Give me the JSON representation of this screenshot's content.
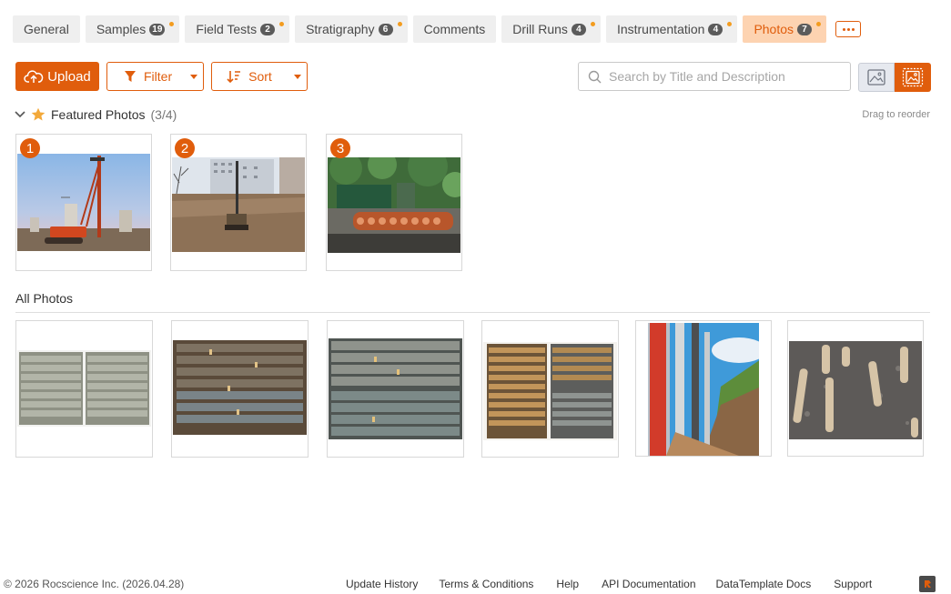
{
  "tabs": [
    {
      "label": "General",
      "badge": null,
      "dot": false,
      "active": false
    },
    {
      "label": "Samples",
      "badge": "19",
      "dot": true,
      "active": false
    },
    {
      "label": "Field Tests",
      "badge": "2",
      "dot": true,
      "active": false
    },
    {
      "label": "Stratigraphy",
      "badge": "6",
      "dot": true,
      "active": false
    },
    {
      "label": "Comments",
      "badge": null,
      "dot": false,
      "active": false
    },
    {
      "label": "Drill Runs",
      "badge": "4",
      "dot": true,
      "active": false
    },
    {
      "label": "Instrumentation",
      "badge": "4",
      "dot": true,
      "active": false
    },
    {
      "label": "Photos",
      "badge": "7",
      "dot": true,
      "active": true
    }
  ],
  "toolbar": {
    "upload_label": "Upload",
    "filter_label": "Filter",
    "sort_label": "Sort",
    "search_placeholder": "Search by Title and Description"
  },
  "featured": {
    "title": "Featured Photos",
    "count": "(3/4)",
    "drag_hint": "Drag to reorder",
    "photos": [
      {
        "number": "1",
        "subject": "drilling rig at sunset"
      },
      {
        "number": "2",
        "subject": "drilling rig on site"
      },
      {
        "number": "3",
        "subject": "core barrel auger"
      }
    ]
  },
  "all_photos": {
    "title": "All Photos",
    "photos": [
      {
        "subject": "core box grey"
      },
      {
        "subject": "core box dark"
      },
      {
        "subject": "core box grey banded"
      },
      {
        "subject": "core box brown"
      },
      {
        "subject": "drilling casing"
      },
      {
        "subject": "core samples on ground"
      }
    ]
  },
  "footer": {
    "copyright": "© 2026 Rocscience Inc. (2026.04.28)",
    "links": [
      "Update History",
      "Terms & Conditions",
      "Help",
      "API Documentation",
      "DataTemplate Docs",
      "Support"
    ]
  },
  "colors": {
    "accent": "#e05d0c",
    "active_tab_bg": "#fdd3b1",
    "dot": "#f39c1f"
  }
}
